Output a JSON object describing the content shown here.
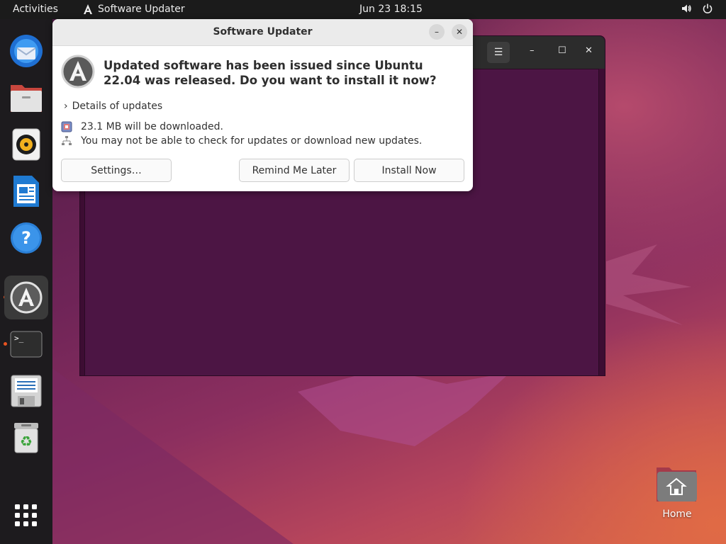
{
  "topbar": {
    "activities": "Activities",
    "app_name": "Software Updater",
    "datetime": "Jun 23  18:15",
    "tray_icons": [
      "volume-icon",
      "power-icon"
    ]
  },
  "dock": {
    "items": [
      {
        "name": "thunderbird-icon",
        "running": false
      },
      {
        "name": "files-icon",
        "running": false
      },
      {
        "name": "rhythmbox-icon",
        "running": false
      },
      {
        "name": "libreoffice-writer-icon",
        "running": false
      },
      {
        "name": "help-icon",
        "running": false
      },
      {
        "name": "software-updater-icon",
        "running": true,
        "active": true
      },
      {
        "name": "terminal-icon",
        "running": true
      },
      {
        "name": "save-disk-icon",
        "running": false
      },
      {
        "name": "trash-icon",
        "running": false
      }
    ],
    "show_apps": "apps-grid-icon"
  },
  "dialog": {
    "title": "Software Updater",
    "heading": "Updated software has been issued since Ubuntu 22.04 was released. Do you want to install it now?",
    "details_label": "Details of updates",
    "download_info": "23.1 MB will be downloaded.",
    "network_warning": "You may not be able to check for updates or download new updates.",
    "buttons": {
      "settings": "Settings…",
      "remind": "Remind Me Later",
      "install": "Install Now"
    }
  },
  "desktop": {
    "home_label": "Home"
  },
  "colors": {
    "accent": "#e95420",
    "topbar": "#1b1b1b",
    "dock": "#1d1b1e"
  }
}
